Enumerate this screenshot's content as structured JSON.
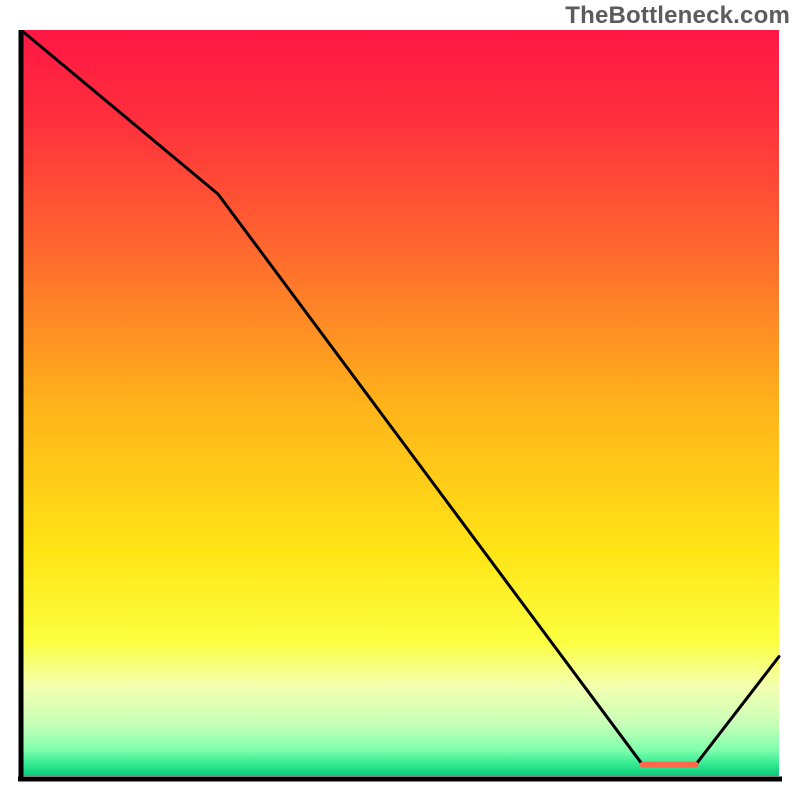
{
  "watermark": "TheBottleneck.com",
  "chart_data": {
    "type": "line",
    "title": "",
    "xlabel": "",
    "ylabel": "",
    "xlim": [
      0,
      100
    ],
    "ylim": [
      0,
      100
    ],
    "x": [
      0,
      26,
      82,
      89,
      100
    ],
    "values": [
      100,
      78,
      1.5,
      1.5,
      16
    ],
    "plateau": {
      "x_start": 82,
      "x_end": 89,
      "y": 1.5,
      "color": "#ff6a4d"
    },
    "background_gradient_stops": [
      {
        "offset": 0.0,
        "color": "#ff1744"
      },
      {
        "offset": 0.12,
        "color": "#ff2f3d"
      },
      {
        "offset": 0.3,
        "color": "#ff6a2e"
      },
      {
        "offset": 0.5,
        "color": "#ffb21a"
      },
      {
        "offset": 0.7,
        "color": "#ffe516"
      },
      {
        "offset": 0.82,
        "color": "#fbff3f"
      },
      {
        "offset": 0.88,
        "color": "#f3ffb0"
      },
      {
        "offset": 0.93,
        "color": "#c8ffb8"
      },
      {
        "offset": 0.965,
        "color": "#7fffad"
      },
      {
        "offset": 0.985,
        "color": "#2fe88f"
      },
      {
        "offset": 1.0,
        "color": "#0cc97a"
      }
    ],
    "line_color": "#000000",
    "line_width": 3,
    "axes": {
      "show_ticks": false,
      "frame": true
    }
  }
}
